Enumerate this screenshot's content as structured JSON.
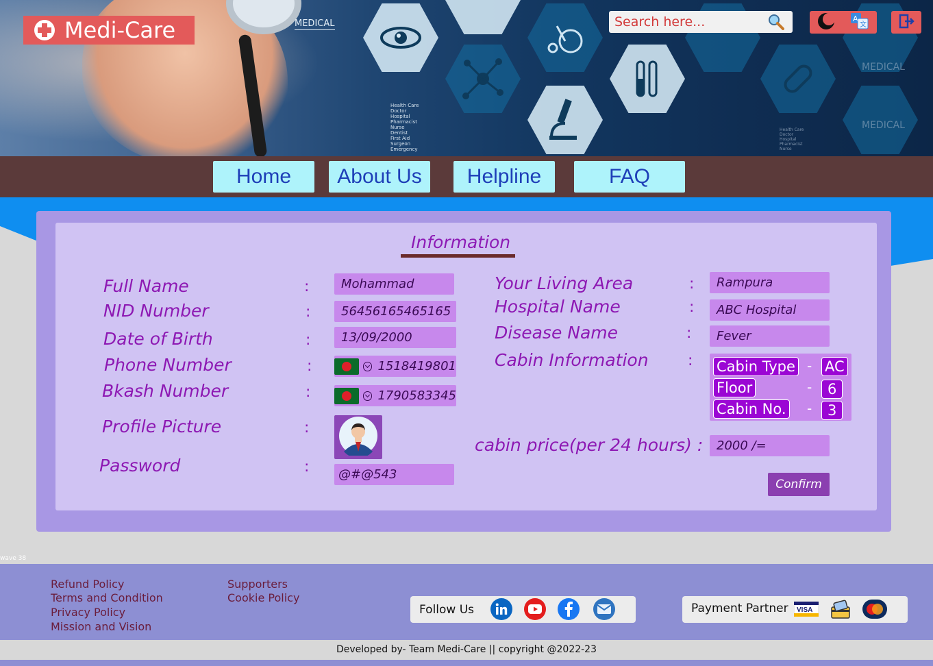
{
  "brand": {
    "name": "Medi-Care"
  },
  "hero": {
    "tag": "MEDICAL",
    "faint_tags": [
      "MEDICAL",
      "MEDICAL"
    ],
    "small_list": [
      "Health Care",
      "Doctor",
      "Hospital",
      "Pharmacist",
      "Nurse",
      "Dentist",
      "First Aid",
      "Surgeon",
      "Emergency"
    ],
    "small_list_right": [
      "Health Care",
      "Doctor",
      "Hospital",
      "Pharmacist",
      "Nurse"
    ]
  },
  "search": {
    "placeholder": "Search here..."
  },
  "nav": {
    "items": [
      "Home",
      "About Us",
      "Helpline",
      "FAQ"
    ]
  },
  "info": {
    "title": "Information",
    "left": {
      "full_name_label": "Full Name",
      "full_name_value": "Mohammad",
      "nid_label": "NID Number",
      "nid_value": "56456165465165",
      "dob_label": "Date of Birth",
      "dob_value": "13/09/2000",
      "phone_label": "Phone Number",
      "phone_value": "1518419801",
      "bkash_label": "Bkash Number",
      "bkash_value": "1790583345",
      "profile_label": "Profile Picture",
      "password_label": "Password",
      "password_value": "@#@543"
    },
    "right": {
      "area_label": "Your Living Area",
      "area_value": "Rampura",
      "hospital_label": "Hospital Name",
      "hospital_value": "ABC Hospital",
      "disease_label": "Disease Name",
      "disease_value": "Fever",
      "cabin_label": "Cabin Information",
      "cabin_type_label": "Cabin Type",
      "cabin_type_value": "AC",
      "floor_label": "Floor",
      "floor_value": "6",
      "cabin_no_label": "Cabin No.",
      "cabin_no_value": "3",
      "price_label": "cabin price(per 24 hours) :",
      "price_value": "2000 /="
    },
    "colon": ":",
    "dash": "-",
    "confirm_label": "Confirm"
  },
  "wave_label": "wave 38",
  "footer": {
    "links_col1": [
      "Refund Policy",
      "Terms and Condition",
      "Privacy Policy",
      "Mission and Vision"
    ],
    "links_col2": [
      "Supporters",
      "Cookie Policy"
    ],
    "follow_label": "Follow Us",
    "social_icons": [
      "linkedin-icon",
      "youtube-icon",
      "facebook-icon",
      "mail-icon"
    ],
    "payment_label": "Payment Partner",
    "payment_icons": [
      "visa-icon",
      "card-icon",
      "mastercard-icon"
    ],
    "copyright": "Developed by- Team Medi-Care || copyright @2022-23"
  },
  "colors": {
    "accent_red": "#e35a5a",
    "nav_bg": "#5b3a3a",
    "nav_button": "#aef3fb",
    "card_outer": "#a897e4",
    "card_inner": "#d0c3f3",
    "label_purple": "#8d18b3",
    "value_bg": "#c788ec",
    "footer_bg": "#8d8fd3"
  }
}
